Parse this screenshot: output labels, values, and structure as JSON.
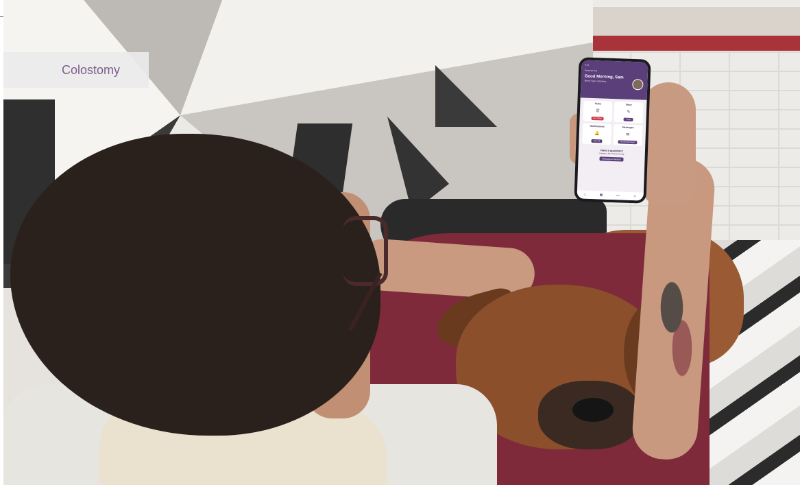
{
  "label": {
    "text": "Colostomy",
    "color": "#7d5d8c"
  },
  "calibration": {
    "gray_swatches": [
      "#111111",
      "#262626",
      "#3b3b3b",
      "#505050",
      "#666666",
      "#7d7d7d",
      "#949494",
      "#ababab",
      "#c2c2c2",
      "#d8d8d8",
      "#ececec",
      "#ffffff"
    ],
    "color_swatches": [
      "#ffed00",
      "#e6007e",
      "#00a0e3",
      "#2e3192",
      "#00a651",
      "#ed1c24",
      "#231f20",
      "#fff799",
      "#f49ac1",
      "#6dcff6",
      "#a7a9ac"
    ]
  },
  "phone_app": {
    "accent": "#5a3f7a",
    "status_time": "9:41",
    "header_small": "Personal Hub",
    "greeting": "Good Morning, Sam",
    "subtitle": "Stoma Type: Colostomy",
    "cards": [
      {
        "title": "Tasks",
        "icon": "task-icon",
        "glyph": "☰",
        "button": "Due Today",
        "button_color": "#d0384a"
      },
      {
        "title": "Diary",
        "icon": "diary-icon",
        "glyph": "✎",
        "button": "+ Entry",
        "button_color": "#5a3f7a"
      },
      {
        "title": "Notifications",
        "icon": "bell-icon",
        "glyph": "🔔",
        "button": "View All",
        "button_color": "#5a3f7a"
      },
      {
        "title": "Messages",
        "icon": "mail-icon",
        "glyph": "✉",
        "button": "No New Messages",
        "button_color": "#5a3f7a"
      }
    ],
    "question_title": "Have a question?",
    "question_body": "Contact a Me+ Nurse for help",
    "message_button": "Message an Advisor",
    "tabs": [
      {
        "name": "home-tab-icon",
        "glyph": "⌂"
      },
      {
        "name": "calendar-tab-icon",
        "glyph": "▦"
      },
      {
        "name": "card-tab-icon",
        "glyph": "▭"
      },
      {
        "name": "profile-tab-icon",
        "glyph": "☺"
      }
    ]
  }
}
